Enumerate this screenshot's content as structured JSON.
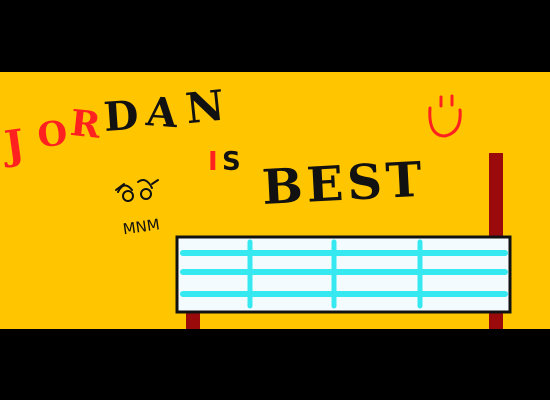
{
  "scene": {
    "background_color": "#000000",
    "panel_color": "#FFC600"
  },
  "texts": {
    "jordan": "JORDAN",
    "is": "IS",
    "best": "BEST",
    "mnm": "MNM"
  },
  "jordan_letters": [
    {
      "char": "J",
      "color": "#FF2020"
    },
    {
      "char": "O",
      "color": "#FF2020"
    },
    {
      "char": "R",
      "color": "#FF2020"
    },
    {
      "char": "D",
      "color": "#111111"
    },
    {
      "char": "A",
      "color": "#111111"
    },
    {
      "char": "N",
      "color": "#111111"
    }
  ],
  "is_letters": [
    {
      "char": "I",
      "color": "#FF2020"
    },
    {
      "char": "S",
      "color": "#111111"
    }
  ],
  "colors": {
    "red": "#FF2020",
    "black": "#111111",
    "post": "#9A0A0A",
    "bench_fill": "#F4FBFF",
    "slats": "#36E8F0",
    "smiley": "#FF2020"
  },
  "icons": [
    "smiley-face-icon",
    "creature-doodle-icon",
    "bench-drawing"
  ]
}
